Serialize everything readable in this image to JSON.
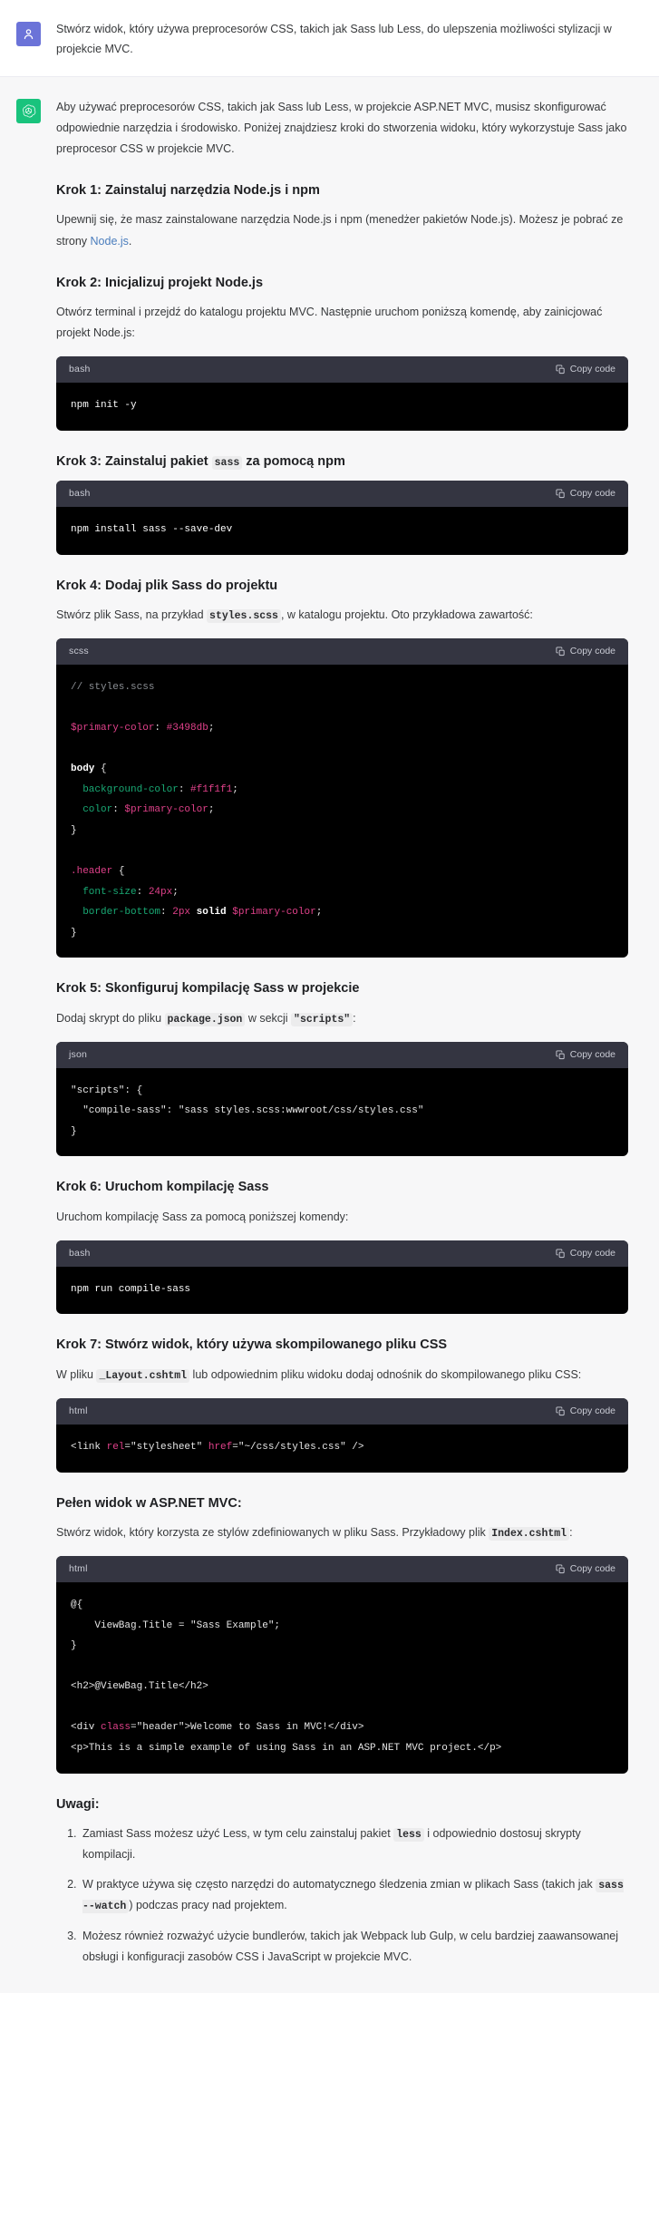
{
  "conversation": {
    "user_message": {
      "avatar_icon": "user-avatar-icon",
      "avatar_color": "#6b73d8",
      "text": "Stwórz widok, który używa preprocesorów CSS, takich jak Sass lub Less, do ulepszenia możliwości stylizacji w projekcie MVC."
    },
    "assistant_message": {
      "avatar_icon": "openai-logo-icon",
      "avatar_color": "#19c37d",
      "intro": "Aby używać preprocesorów CSS, takich jak Sass lub Less, w projekcie ASP.NET MVC, musisz skonfigurować odpowiednie narzędzia i środowisko. Poniżej znajdziesz kroki do stworzenia widoku, który wykorzystuje Sass jako preprocesor CSS w projekcie MVC.",
      "sections": [
        {
          "heading": "Krok 1: Zainstaluj narzędzia Node.js i npm",
          "paragraph_pre": "Upewnij się, że masz zainstalowane narzędzia Node.js i npm (menedżer pakietów Node.js). Możesz je pobrać ze strony ",
          "link_text": "Node.js",
          "paragraph_post": "."
        },
        {
          "heading": "Krok 2: Inicjalizuj projekt Node.js",
          "paragraph": "Otwórz terminal i przejdź do katalogu projektu MVC. Następnie uruchom poniższą komendę, aby zainicjować projekt Node.js:"
        },
        {
          "heading_parts": [
            "Krok 3: Zainstaluj pakiet ",
            "sass",
            " za pomocą npm"
          ]
        },
        {
          "heading": "Krok 4: Dodaj plik Sass do projektu",
          "paragraph_pre": "Stwórz plik Sass, na przykład ",
          "code": "styles.scss",
          "paragraph_post": ", w katalogu projektu. Oto przykładowa zawartość:"
        },
        {
          "heading": "Krok 5: Skonfiguruj kompilację Sass w projekcie",
          "paragraph_pre": "Dodaj skrypt do pliku ",
          "code1": "package.json",
          "paragraph_mid": " w sekcji ",
          "code2": "\"scripts\"",
          "paragraph_post": ":"
        },
        {
          "heading": "Krok 6: Uruchom kompilację Sass",
          "paragraph": "Uruchom kompilację Sass za pomocą poniższej komendy:"
        },
        {
          "heading": "Krok 7: Stwórz widok, który używa skompilowanego pliku CSS",
          "paragraph_pre": "W pliku ",
          "code": "_Layout.cshtml",
          "paragraph_post": " lub odpowiednim pliku widoku dodaj odnośnik do skompilowanego pliku CSS:"
        },
        {
          "heading": "Pełen widok w ASP.NET MVC:",
          "paragraph_pre": "Stwórz widok, który korzysta ze stylów zdefiniowanych w pliku Sass. Przykładowy plik ",
          "code": "Index.cshtml",
          "paragraph_post": ":"
        }
      ],
      "notes_heading": "Uwagi:",
      "notes": [
        {
          "pre": "Zamiast Sass możesz użyć Less, w tym celu zainstaluj pakiet ",
          "code": "less",
          "post": " i odpowiednio dostosuj skrypty kompilacji."
        },
        {
          "pre": "W praktyce używa się często narzędzi do automatycznego śledzenia zmian w plikach Sass (takich jak ",
          "code": "sass --watch",
          "post": ") podczas pracy nad projektem."
        },
        {
          "pre": "Możesz również rozważyć użycie bundlerów, takich jak Webpack lub Gulp, w celu bardziej zaawansowanej obsługi i konfiguracji zasobów CSS i JavaScript w projekcie MVC.",
          "code": "",
          "post": ""
        }
      ]
    }
  },
  "code_blocks": [
    {
      "id": "cb1",
      "lang": "bash",
      "copy_label": "Copy code",
      "code": "npm init -y"
    },
    {
      "id": "cb2",
      "lang": "bash",
      "copy_label": "Copy code",
      "code": "npm install sass --save-dev"
    },
    {
      "id": "cb3",
      "lang": "scss",
      "copy_label": "Copy code",
      "code": "// styles.scss\n\n$primary-color: #3498db;\n\nbody {\n  background-color: #f1f1f1;\n  color: $primary-color;\n}\n\n.header {\n  font-size: 24px;\n  border-bottom: 2px solid $primary-color;\n}"
    },
    {
      "id": "cb4",
      "lang": "json",
      "copy_label": "Copy code",
      "code": "\"scripts\": {\n  \"compile-sass\": \"sass styles.scss:wwwroot/css/styles.css\"\n}"
    },
    {
      "id": "cb5",
      "lang": "bash",
      "copy_label": "Copy code",
      "code": "npm run compile-sass"
    },
    {
      "id": "cb6",
      "lang": "html",
      "copy_label": "Copy code",
      "code": "<link rel=\"stylesheet\" href=\"~/css/styles.css\" />"
    },
    {
      "id": "cb7",
      "lang": "html",
      "copy_label": "Copy code",
      "code": "@{\n    ViewBag.Title = \"Sass Example\";\n}\n\n<h2>@ViewBag.Title</h2>\n\n<div class=\"header\">Welcome to Sass in MVC!</div>\n<p>This is a simple example of using Sass in an ASP.NET MVC project.</p>"
    }
  ],
  "colors": {
    "user_avatar": "#6b73d8",
    "assistant_avatar": "#19c37d",
    "assistant_bg": "#f7f7f8",
    "code_header_bg": "#343541",
    "code_body_bg": "#000000",
    "link": "#4a7dbd",
    "syntax_pink": "#e0418a",
    "syntax_green": "#19a974",
    "syntax_comment": "#8b8f94"
  }
}
